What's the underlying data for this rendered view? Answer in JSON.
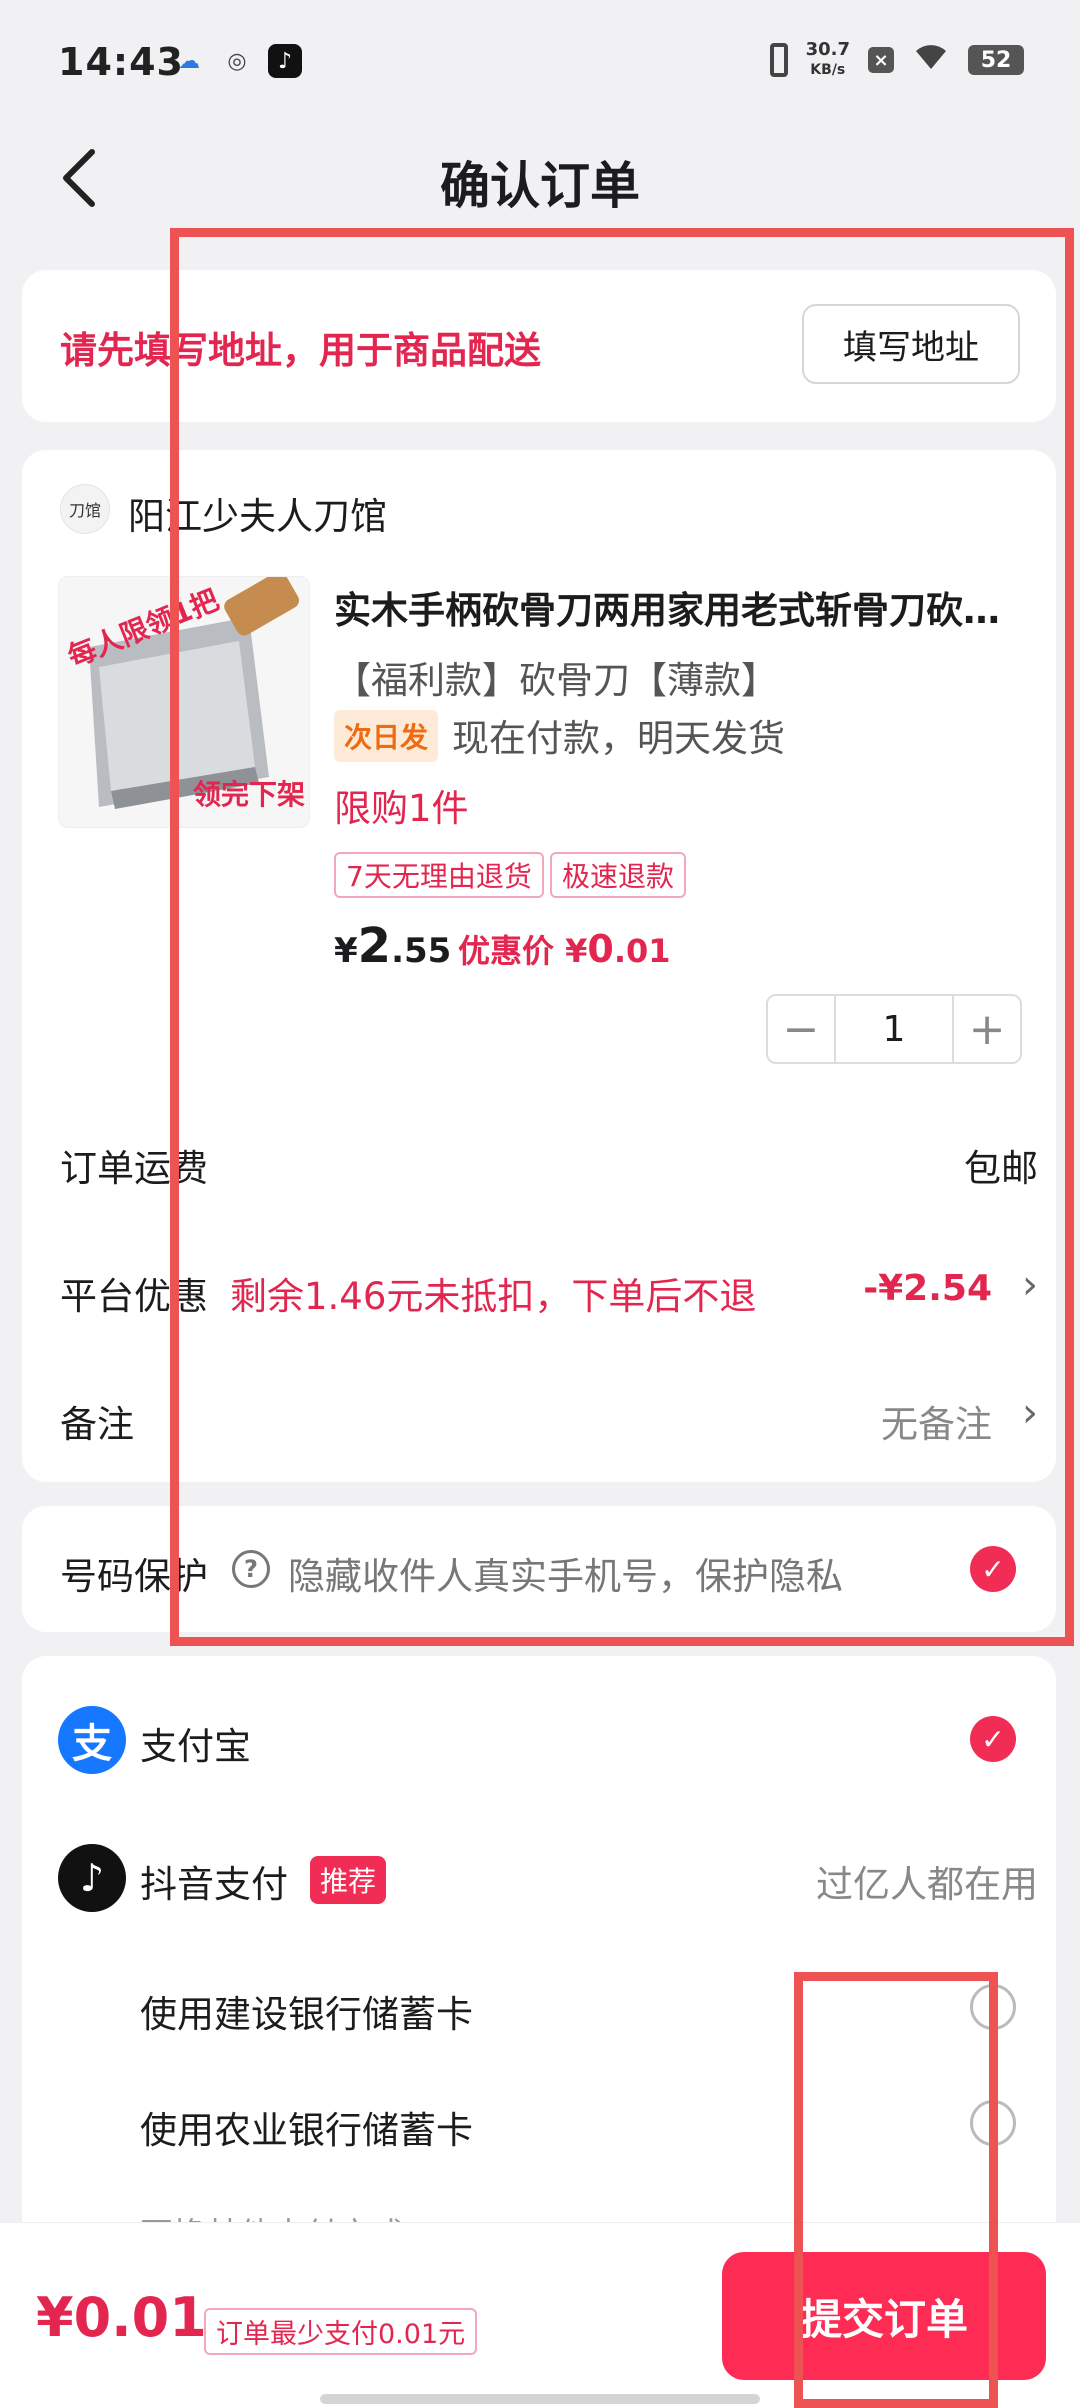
{
  "status_bar": {
    "time": "14:43",
    "net_speed_value": "30.7",
    "net_speed_unit": "KB/s",
    "battery": "52"
  },
  "header": {
    "title": "确认订单"
  },
  "address": {
    "tip": "请先填写地址，用于商品配送",
    "button": "填写地址"
  },
  "shop": {
    "logo_text": "刀馆",
    "name": "阳江少夫人刀馆"
  },
  "product": {
    "image_text_top": "每人限领1把",
    "image_text_bottom": "领完下架",
    "title": "实木手柄砍骨刀两用家用老式斩骨刀砍骨剁骨刀具",
    "spec": "【福利款】砍骨刀【薄款】",
    "ship_badge": "次日发",
    "ship_text": "现在付款，明天发货",
    "limit": "限购1件",
    "tags": [
      "7天无理由退货",
      "极速退款"
    ],
    "price_symbol": "¥",
    "price_int": "2",
    "price_dec": ".55",
    "discount_label": "优惠价",
    "discount_symbol": "¥",
    "discount_int": "0",
    "discount_dec": ".01",
    "quantity": "1"
  },
  "rows": {
    "shipping_label": "订单运费",
    "shipping_value": "包邮",
    "promo_label": "平台优惠",
    "promo_note": "剩余1.46元未抵扣，下单后不退",
    "promo_value": "-¥2.54",
    "remark_label": "备注",
    "remark_value": "无备注"
  },
  "privacy": {
    "label": "号码保护",
    "text": "隐藏收件人真实手机号，保护隐私"
  },
  "payment": {
    "alipay": "支付宝",
    "douyin": "抖音支付",
    "recommend": "推荐",
    "douyin_slogan": "过亿人都在用",
    "ccb": "使用建设银行储蓄卡",
    "abc": "使用农业银行储蓄卡",
    "more": "更换其他支付方式"
  },
  "footer": {
    "total": "¥0.01",
    "min_pay": "订单最少支付0.01元",
    "submit": "提交订单"
  },
  "colors": {
    "accent": "#fe2c55",
    "annotation": "#ee5252",
    "alipay_blue": "#1677ff"
  }
}
